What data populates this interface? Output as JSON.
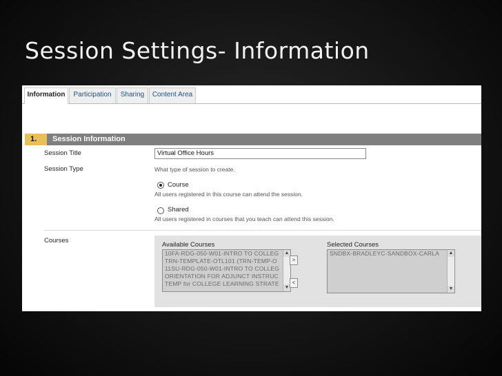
{
  "slide": {
    "title": "Session Settings- Information"
  },
  "tabs": [
    {
      "label": "Information"
    },
    {
      "label": "Participation"
    },
    {
      "label": "Sharing"
    },
    {
      "label": "Content Area"
    }
  ],
  "section": {
    "number": "1.",
    "title": "Session Information"
  },
  "fields": {
    "session_title_label": "Session Title",
    "session_title_value": "Virtual Office Hours",
    "session_type_label": "Session Type",
    "session_type_desc": "What type of session to create.",
    "option_course_label": "Course",
    "option_course_desc": "All users registered in this course can attend the session.",
    "option_shared_label": "Shared",
    "option_shared_desc": "All users registered in courses that you teach can attend this session.",
    "selected_option": "Course",
    "courses_label": "Courses"
  },
  "courses": {
    "available_label": "Available Courses",
    "available": [
      "10FA-RDG-050-W01-INTRO TO COLLEG",
      "TRN-TEMPLATE-OTL101 (TRN-TEMP-O",
      "11SU-RDG-050-W01-INTRO TO COLLEG",
      "ORIENTATION FOR ADJUNCT INSTRUC",
      "TEMP for COLLEGE LEARNING STRATE"
    ],
    "selected_label": "Selected Courses",
    "selected": [
      "SNDBX-BRADLEYC-SANDBOX-CARLA"
    ],
    "add_symbol": ">",
    "remove_symbol": "<"
  },
  "icons": {
    "scroll_up": "scroll-up-arrow-icon",
    "scroll_down": "scroll-down-arrow-icon"
  },
  "colors": {
    "section_bar": "#7f7f7f",
    "step_badge": "#e7c05b",
    "tab_link": "#1d4f8a"
  }
}
